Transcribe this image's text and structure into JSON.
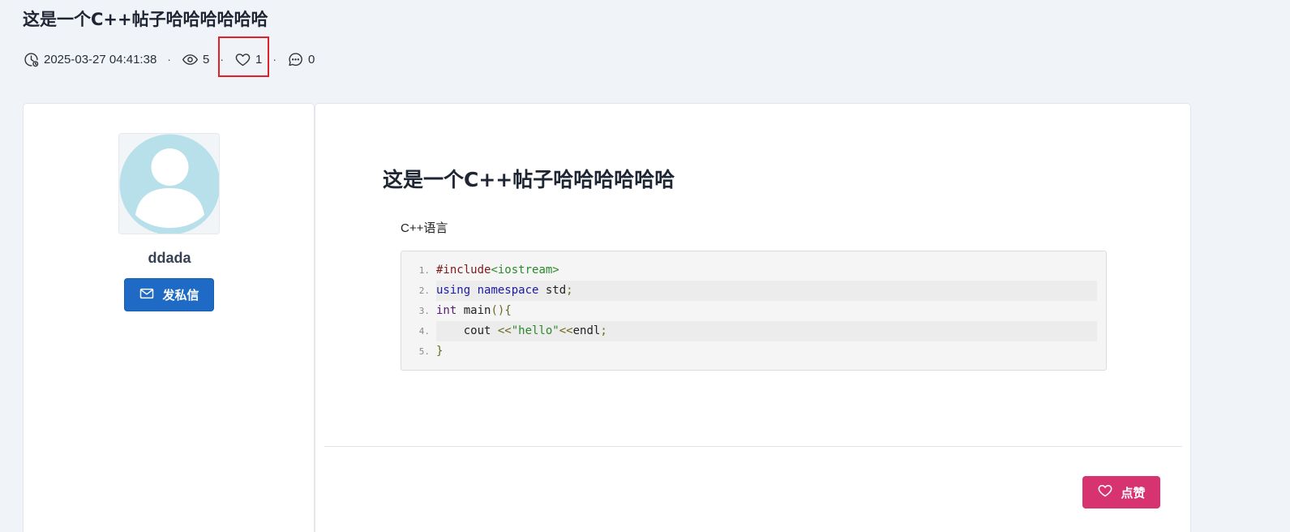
{
  "page_title": "这是一个C++帖子哈哈哈哈哈哈",
  "meta": {
    "date": "2025-03-27 04:41:38",
    "views": "5",
    "likes": "1",
    "comments": "0",
    "separator": "·"
  },
  "author": {
    "name": "ddada",
    "message_button": "发私信"
  },
  "post": {
    "title": "这是一个C++帖子哈哈哈哈哈哈",
    "subtitle": "C++语言",
    "code_lines": [
      {
        "num": "1.",
        "text": "#include<iostream>"
      },
      {
        "num": "2.",
        "text": "using namespace std;"
      },
      {
        "num": "3.",
        "text": "int main(){"
      },
      {
        "num": "4.",
        "text": "    cout <<\"hello\"<<endl;"
      },
      {
        "num": "5.",
        "text": "}"
      }
    ]
  },
  "like_button": "点赞",
  "colors": {
    "primary": "#1e6ac4",
    "like": "#d63370",
    "highlight": "#e0202a",
    "avatar": "#b8e0ea"
  }
}
